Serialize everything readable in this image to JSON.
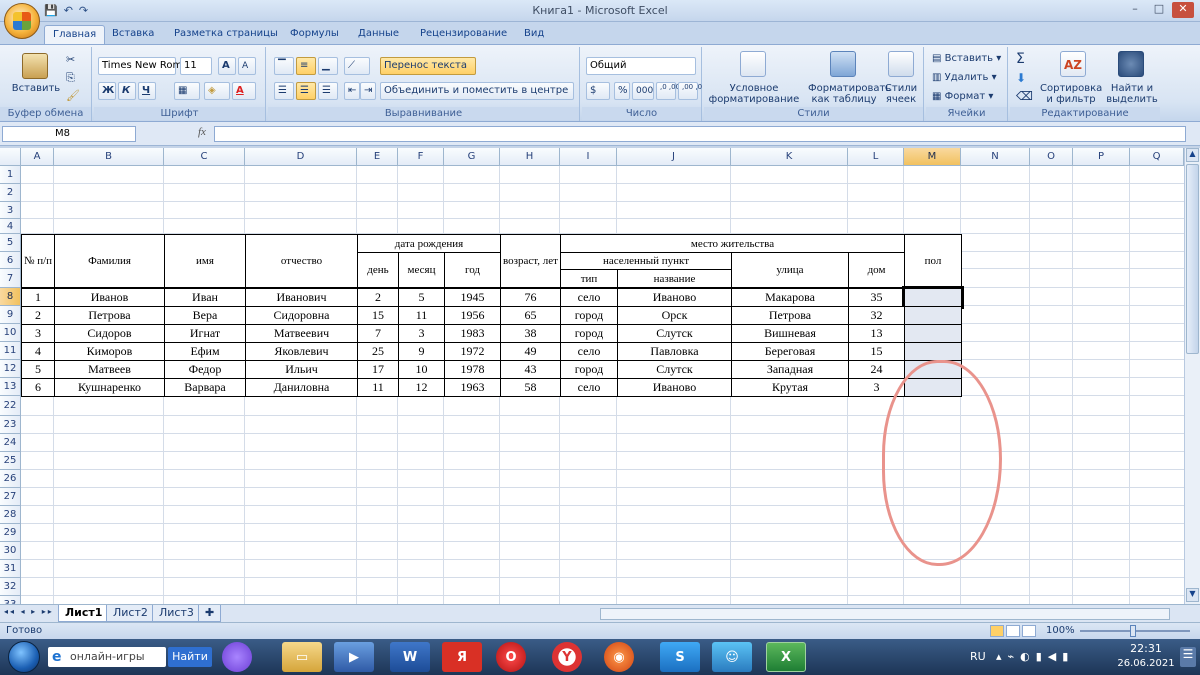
{
  "window": {
    "title": "Книга1 - Microsoft Excel",
    "min": "–",
    "max": "□",
    "close": "✕"
  },
  "qat": {
    "save": "💾",
    "undo": "↶",
    "redo": "↷"
  },
  "tabs": [
    "Главная",
    "Вставка",
    "Разметка страницы",
    "Формулы",
    "Данные",
    "Рецензирование",
    "Вид"
  ],
  "ribbon": {
    "clipboard": {
      "paste": "Вставить",
      "label": "Буфер обмена"
    },
    "font": {
      "name": "Times New Rom",
      "size": "11",
      "grow": "A",
      "shrink": "A",
      "bold": "Ж",
      "italic": "К",
      "underline": "Ч",
      "fontcolor": "A",
      "label": "Шрифт"
    },
    "align": {
      "wrap": "Перенос текста",
      "merge": "Объединить и поместить в центре",
      "label": "Выравнивание"
    },
    "number": {
      "format": "Общий",
      "currency": "$",
      "percent": "%",
      "thousands": "000",
      "inc": ",0 ,00",
      "dec": ",00 ,0",
      "label": "Число"
    },
    "styles": {
      "cond": "Условное форматирование",
      "table": "Форматировать как таблицу",
      "cell": "Стили ячеек",
      "label": "Стили"
    },
    "cells": {
      "insert": "Вставить",
      "delete": "Удалить",
      "format": "Формат",
      "label": "Ячейки"
    },
    "edit": {
      "sum": "Σ",
      "sort": "Сортировка и фильтр",
      "find": "Найти и выделить",
      "label": "Редактирование"
    }
  },
  "formula": {
    "namebox": "M8",
    "fx": "fx",
    "value": ""
  },
  "columns": [
    "A",
    "B",
    "C",
    "D",
    "E",
    "F",
    "G",
    "H",
    "I",
    "J",
    "K",
    "L",
    "M",
    "N",
    "O",
    "P",
    "Q"
  ],
  "rows": [
    "1",
    "2",
    "3",
    "4",
    "5",
    "6",
    "7",
    "8",
    "9",
    "10",
    "11",
    "12",
    "13",
    "22",
    "23",
    "24",
    "25",
    "26",
    "27",
    "28",
    "29",
    "30",
    "31",
    "32",
    "33"
  ],
  "table": {
    "headers": {
      "num": "№ п/п",
      "surname": "Фамилия",
      "name": "имя",
      "patronymic": "отчество",
      "birth": "дата рождения",
      "day": "день",
      "month": "месяц",
      "year": "год",
      "age": "возраст, лет",
      "residence": "место жительства",
      "settlement": "населенный пункт",
      "type": "тип",
      "title": "название",
      "street": "улица",
      "house": "дом",
      "sex": "пол"
    },
    "rows": [
      [
        "1",
        "Иванов",
        "Иван",
        "Иванович",
        "2",
        "5",
        "1945",
        "76",
        "село",
        "Иваново",
        "Макарова",
        "35"
      ],
      [
        "2",
        "Петрова",
        "Вера",
        "Сидоровна",
        "15",
        "11",
        "1956",
        "65",
        "город",
        "Орск",
        "Петрова",
        "32"
      ],
      [
        "3",
        "Сидоров",
        "Игнат",
        "Матвеевич",
        "7",
        "3",
        "1983",
        "38",
        "город",
        "Слутск",
        "Вишневая",
        "13"
      ],
      [
        "4",
        "Киморов",
        "Ефим",
        "Яковлевич",
        "25",
        "9",
        "1972",
        "49",
        "село",
        "Павловка",
        "Береговая",
        "15"
      ],
      [
        "5",
        "Матвеев",
        "Федор",
        "Ильич",
        "17",
        "10",
        "1978",
        "43",
        "город",
        "Слутск",
        "Западная",
        "24"
      ],
      [
        "6",
        "Кушнаренко",
        "Варвара",
        "Даниловна",
        "11",
        "12",
        "1963",
        "58",
        "село",
        "Иваново",
        "Крутая",
        "3"
      ]
    ]
  },
  "sheets": [
    "Лист1",
    "Лист2",
    "Лист3"
  ],
  "status": {
    "ready": "Готово",
    "zoom": "100%"
  },
  "taskbar": {
    "search": "онлайн-игры",
    "go": "Найти",
    "lang": "RU",
    "time": "22:31",
    "date": "26.06.2021"
  }
}
